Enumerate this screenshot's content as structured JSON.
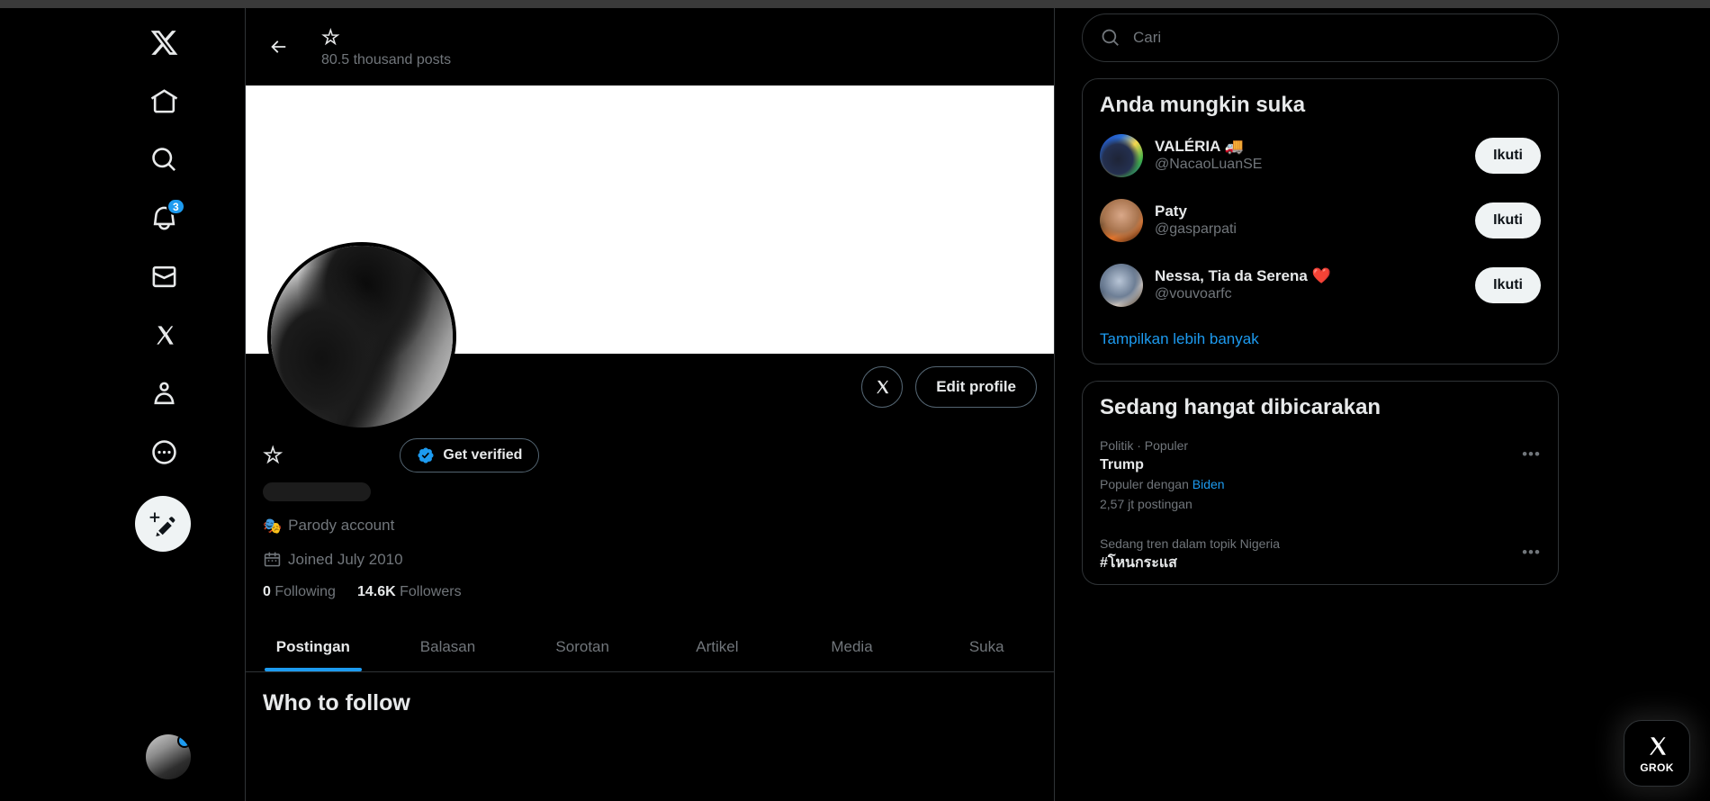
{
  "nav": {
    "items": [
      {
        "name": "x-logo",
        "icon": "x-logo-icon"
      },
      {
        "name": "home",
        "icon": "home-icon"
      },
      {
        "name": "explore",
        "icon": "search-icon"
      },
      {
        "name": "notifications",
        "icon": "bell-icon",
        "badge": "3"
      },
      {
        "name": "messages",
        "icon": "envelope-icon"
      },
      {
        "name": "grok",
        "icon": "grok-icon"
      },
      {
        "name": "profile",
        "icon": "person-icon"
      },
      {
        "name": "more",
        "icon": "more-dots-icon"
      }
    ],
    "compose_icon": "compose-post-icon",
    "notifications_badge": "3"
  },
  "header": {
    "back_icon": "arrow-left-icon",
    "display_name": "☆",
    "post_count": "80.5 thousand posts"
  },
  "profile": {
    "display_name": "☆",
    "grok_icon": "grok-icon",
    "edit_profile_label": "Edit profile",
    "get_verified_label": "Get verified",
    "verified_badge_icon": "verified-badge-icon",
    "parody_emoji": "🎭",
    "parody_label": "Parody account",
    "joined_icon": "calendar-icon",
    "joined_label": "Joined July 2010",
    "following_count": "0",
    "following_label": "Following",
    "followers_count": "14.6K",
    "followers_label": "Followers"
  },
  "tabs": [
    {
      "label": "Postingan",
      "active": true
    },
    {
      "label": "Balasan",
      "active": false
    },
    {
      "label": "Sorotan",
      "active": false
    },
    {
      "label": "Artikel",
      "active": false
    },
    {
      "label": "Media",
      "active": false
    },
    {
      "label": "Suka",
      "active": false
    }
  ],
  "feed": {
    "who_to_follow_heading": "Who to follow"
  },
  "search": {
    "placeholder": "Cari",
    "icon": "search-icon"
  },
  "suggestions": {
    "title": "Anda mungkin suka",
    "show_more_label": "Tampilkan lebih banyak",
    "follow_label": "Ikuti",
    "users": [
      {
        "name": "VALÉRIA 🚚",
        "handle": "@NacaoLuanSE"
      },
      {
        "name": "Paty",
        "handle": "@gasparpati"
      },
      {
        "name": "Nessa, Tia da Serena ❤️",
        "handle": "@vouvoarfc"
      }
    ]
  },
  "trends": {
    "title": "Sedang hangat dibicarakan",
    "items": [
      {
        "category": "Politik · Populer",
        "name": "Trump",
        "sub_prefix": "Populer dengan",
        "sub_link": "Biden",
        "count": "2,57 jt postingan",
        "more_icon": "more-dots-icon"
      },
      {
        "category": "Sedang tren dalam topik Nigeria",
        "name": "#โหนกระแส",
        "sub_prefix": "",
        "sub_link": "",
        "count": "",
        "more_icon": "more-dots-icon"
      }
    ]
  },
  "grok_fab": {
    "label": "GROK",
    "icon": "grok-icon"
  },
  "colors": {
    "accent": "#1d9bf0",
    "background": "#000000",
    "border": "#2f3336",
    "muted_text": "#71767b",
    "primary_text": "#e7e9ea",
    "button_white": "#eff3f4"
  }
}
